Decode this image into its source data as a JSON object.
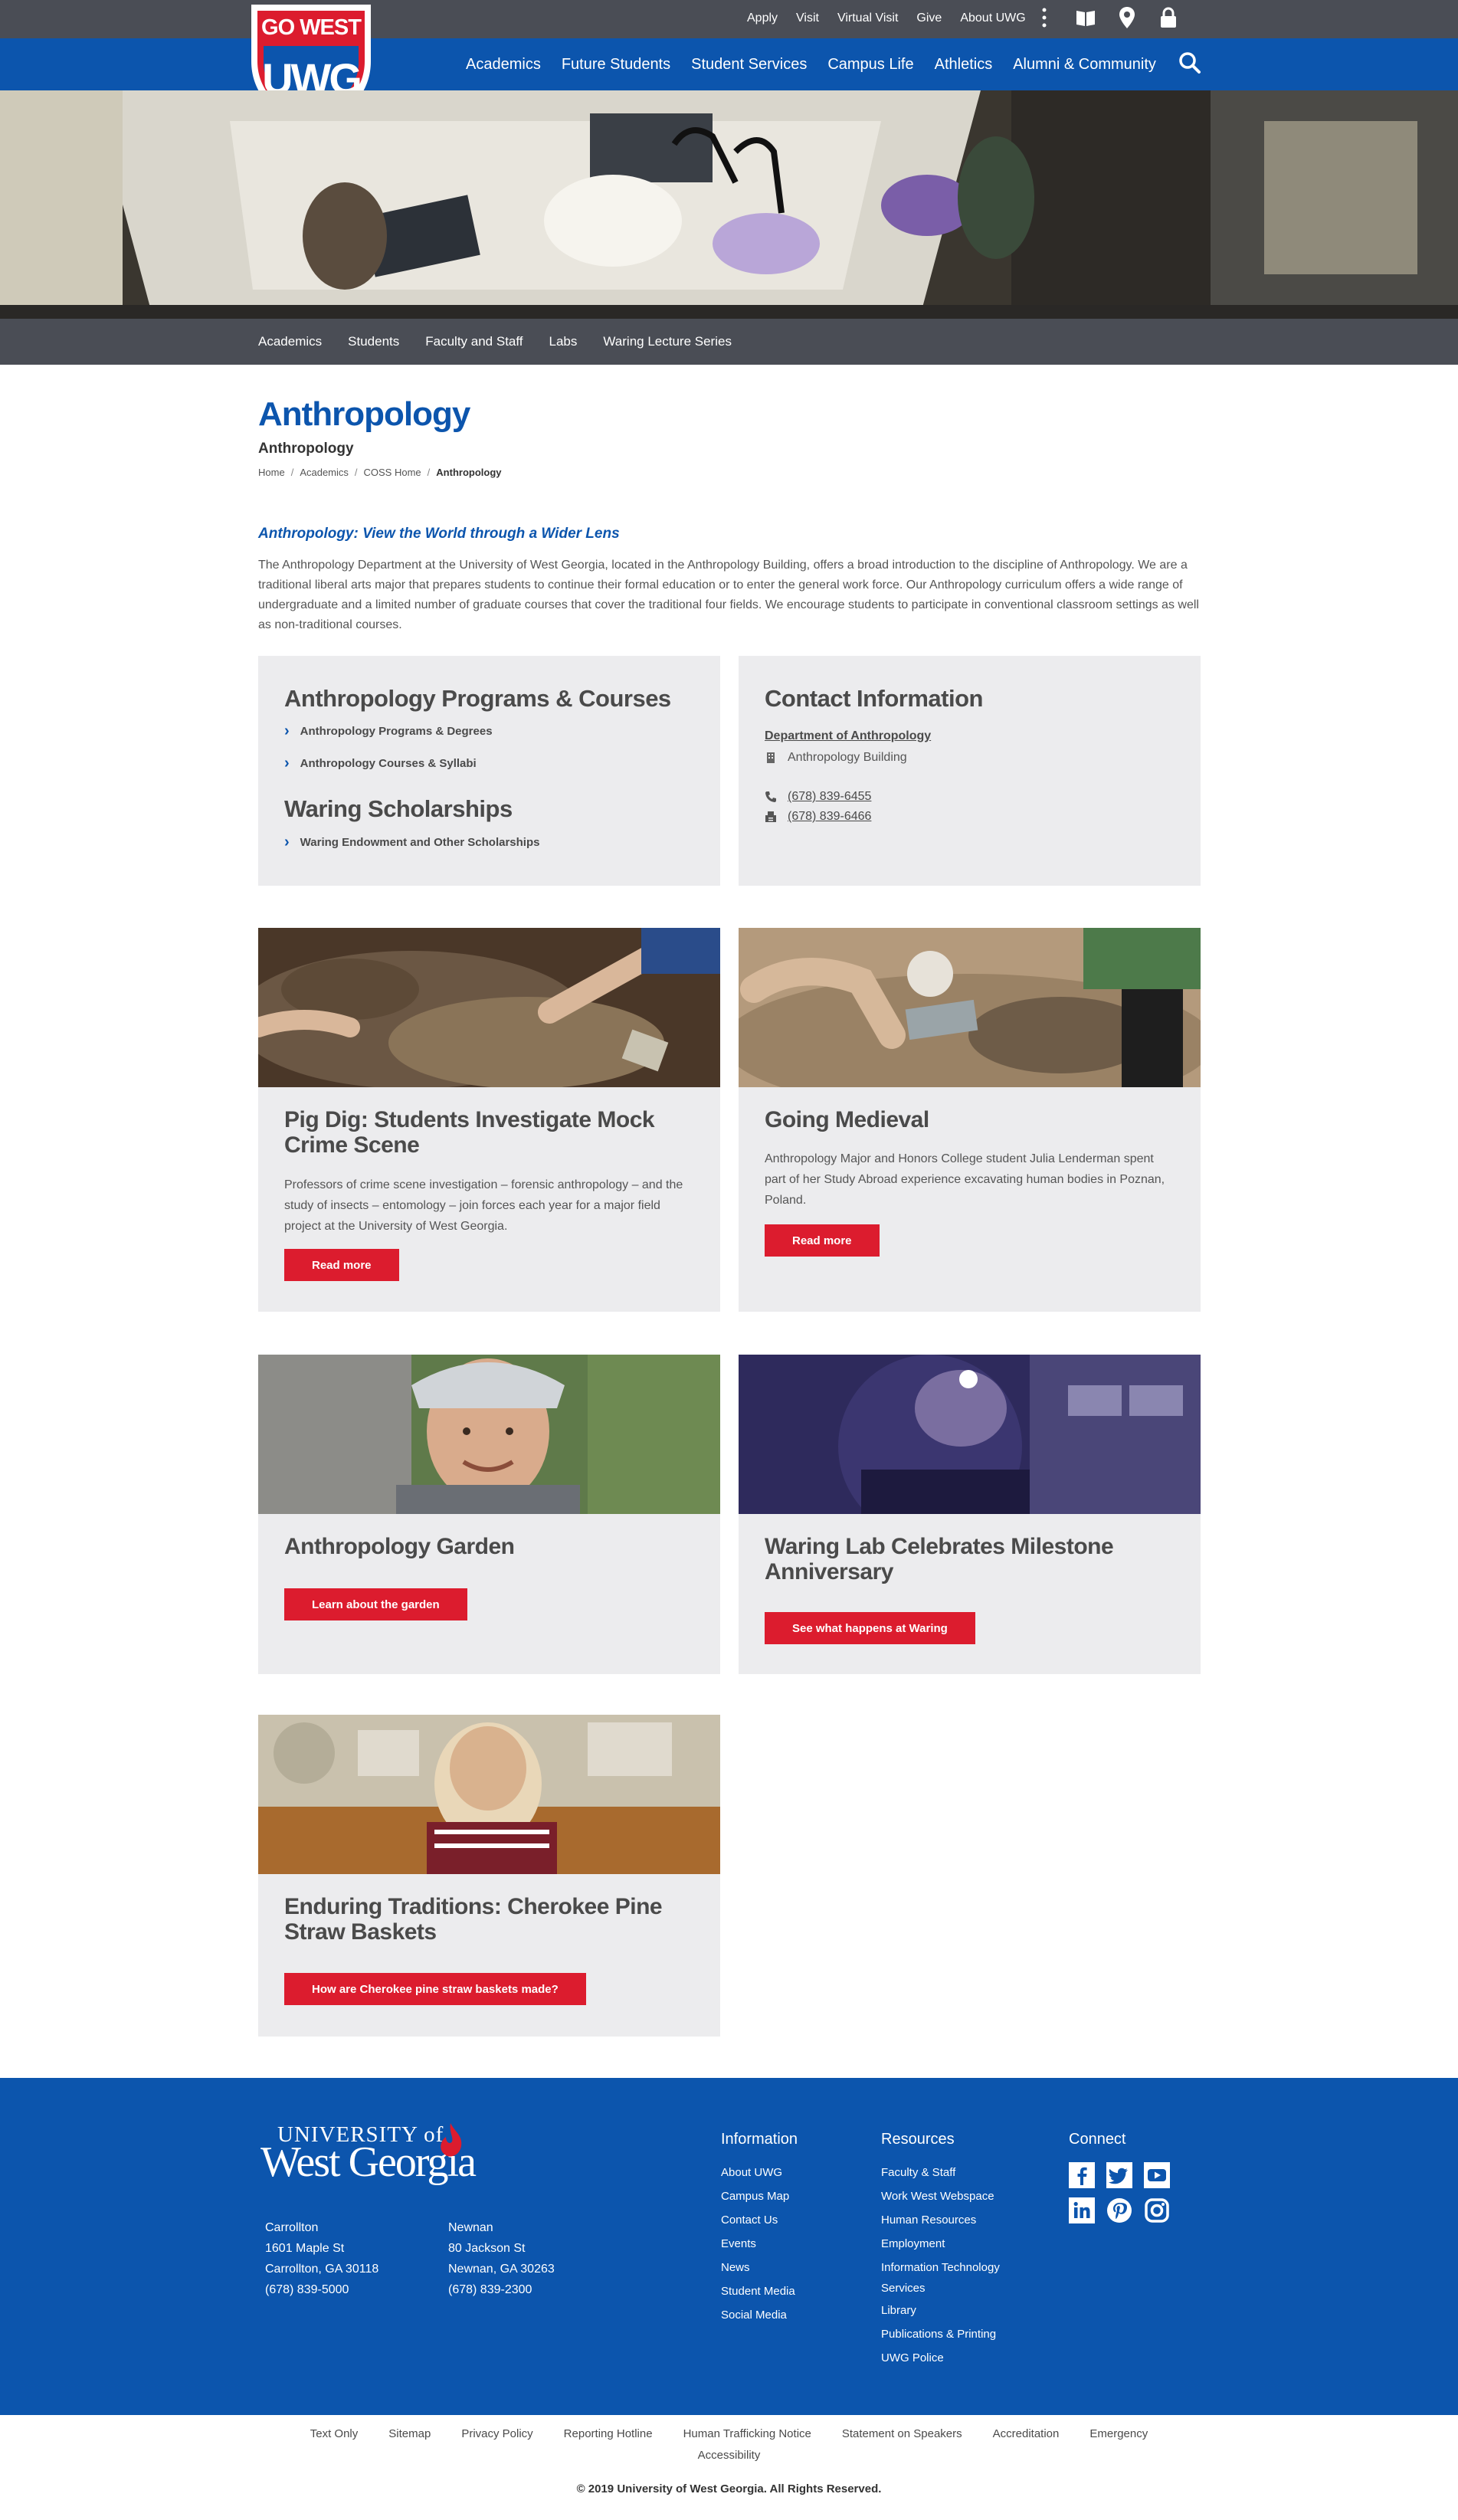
{
  "utility": {
    "links": [
      "Apply",
      "Visit",
      "Virtual Visit",
      "Give",
      "About UWG"
    ],
    "icons": [
      "more-vertical-icon",
      "book-icon",
      "map-pin-icon",
      "lock-icon"
    ]
  },
  "logo": {
    "top": "GO WEST",
    "bottom": "UWG"
  },
  "main_nav": {
    "items": [
      "Academics",
      "Future Students",
      "Student Services",
      "Campus Life",
      "Athletics",
      "Alumni & Community"
    ],
    "search_icon": "search-icon"
  },
  "sub_nav": {
    "items": [
      "Academics",
      "Students",
      "Faculty and Staff",
      "Labs",
      "Waring Lecture Series"
    ]
  },
  "page": {
    "title": "Anthropology",
    "subtitle": "Anthropology",
    "breadcrumb": [
      "Home",
      "Academics",
      "COSS Home",
      "Anthropology"
    ],
    "intro_heading": "Anthropology: View the World through a Wider Lens",
    "intro_text": "The Anthropology Department at the University of West Georgia, located in the Anthropology Building, offers a broad introduction to the discipline of Anthropology. We are a traditional liberal arts major that prepares students to continue their formal education or to enter the general work force. Our Anthropology curriculum offers a wide range of undergraduate and a limited number of graduate courses that cover the traditional four fields. We encourage students to participate in conventional classroom settings as well as non-traditional courses."
  },
  "programs_box": {
    "heading1": "Anthropology Programs & Courses",
    "links1": [
      "Anthropology Programs & Degrees",
      "Anthropology Courses & Syllabi"
    ],
    "heading2": "Waring Scholarships",
    "links2": [
      "Waring Endowment and Other Scholarships"
    ]
  },
  "contact_box": {
    "heading": "Contact Information",
    "department": "Department of Anthropology",
    "building": "Anthropology Building",
    "phone": "(678) 839-6455",
    "fax": "(678) 839-6466"
  },
  "cards": [
    {
      "title": "Pig Dig: Students Investigate Mock Crime Scene",
      "text": "Professors of crime scene investigation – forensic anthropology – and the study of insects – entomology – join forces each year for a major field project at the University of West Georgia.",
      "button": "Read more"
    },
    {
      "title": "Going Medieval",
      "text": "Anthropology Major and Honors College student Julia Lenderman spent part of her Study Abroad experience excavating human bodies in Poznan, Poland.",
      "button": "Read more"
    },
    {
      "title": "Anthropology Garden",
      "text": "",
      "button": "Learn about the garden"
    },
    {
      "title": "Waring Lab Celebrates Milestone Anniversary",
      "text": "",
      "button": "See what happens at Waring"
    },
    {
      "title": "Enduring Traditions: Cherokee Pine Straw Baskets",
      "text": "",
      "button": "How are Cherokee pine straw baskets made?"
    }
  ],
  "footer": {
    "logo_line1": "UNIVERSITY of",
    "logo_line2": "West Georgia",
    "carrollton": {
      "name": "Carrollton",
      "street": "1601 Maple St",
      "city": "Carrollton, GA 30118",
      "phone": "(678) 839-5000"
    },
    "newnan": {
      "name": "Newnan",
      "street": "80 Jackson St",
      "city": "Newnan, GA 30263",
      "phone": "(678) 839-2300"
    },
    "information": {
      "heading": "Information",
      "items": [
        "About UWG",
        "Campus Map",
        "Contact Us",
        "Events",
        "News",
        "Student Media",
        "Social Media"
      ]
    },
    "resources": {
      "heading": "Resources",
      "items": [
        "Faculty & Staff",
        "Work West Webspace",
        "Human Resources",
        "Employment",
        "Information Technology Services",
        "Library",
        "Publications & Printing",
        "UWG Police"
      ]
    },
    "connect": {
      "heading": "Connect",
      "icons": [
        "facebook-icon",
        "twitter-icon",
        "youtube-icon",
        "linkedin-icon",
        "pinterest-icon",
        "instagram-icon"
      ]
    }
  },
  "bottom": {
    "links": [
      "Text Only",
      "Sitemap",
      "Privacy Policy",
      "Reporting Hotline",
      "Human Trafficking Notice",
      "Statement on Speakers",
      "Accreditation",
      "Emergency"
    ],
    "links_row2": "Accessibility",
    "copyright": "© 2019 University of West Georgia. All Rights Reserved."
  },
  "colors": {
    "brand_blue": "#0c55ad",
    "nav_gray": "#4a4d55",
    "button_red": "#dc1c2e",
    "box_gray": "#ececee"
  }
}
